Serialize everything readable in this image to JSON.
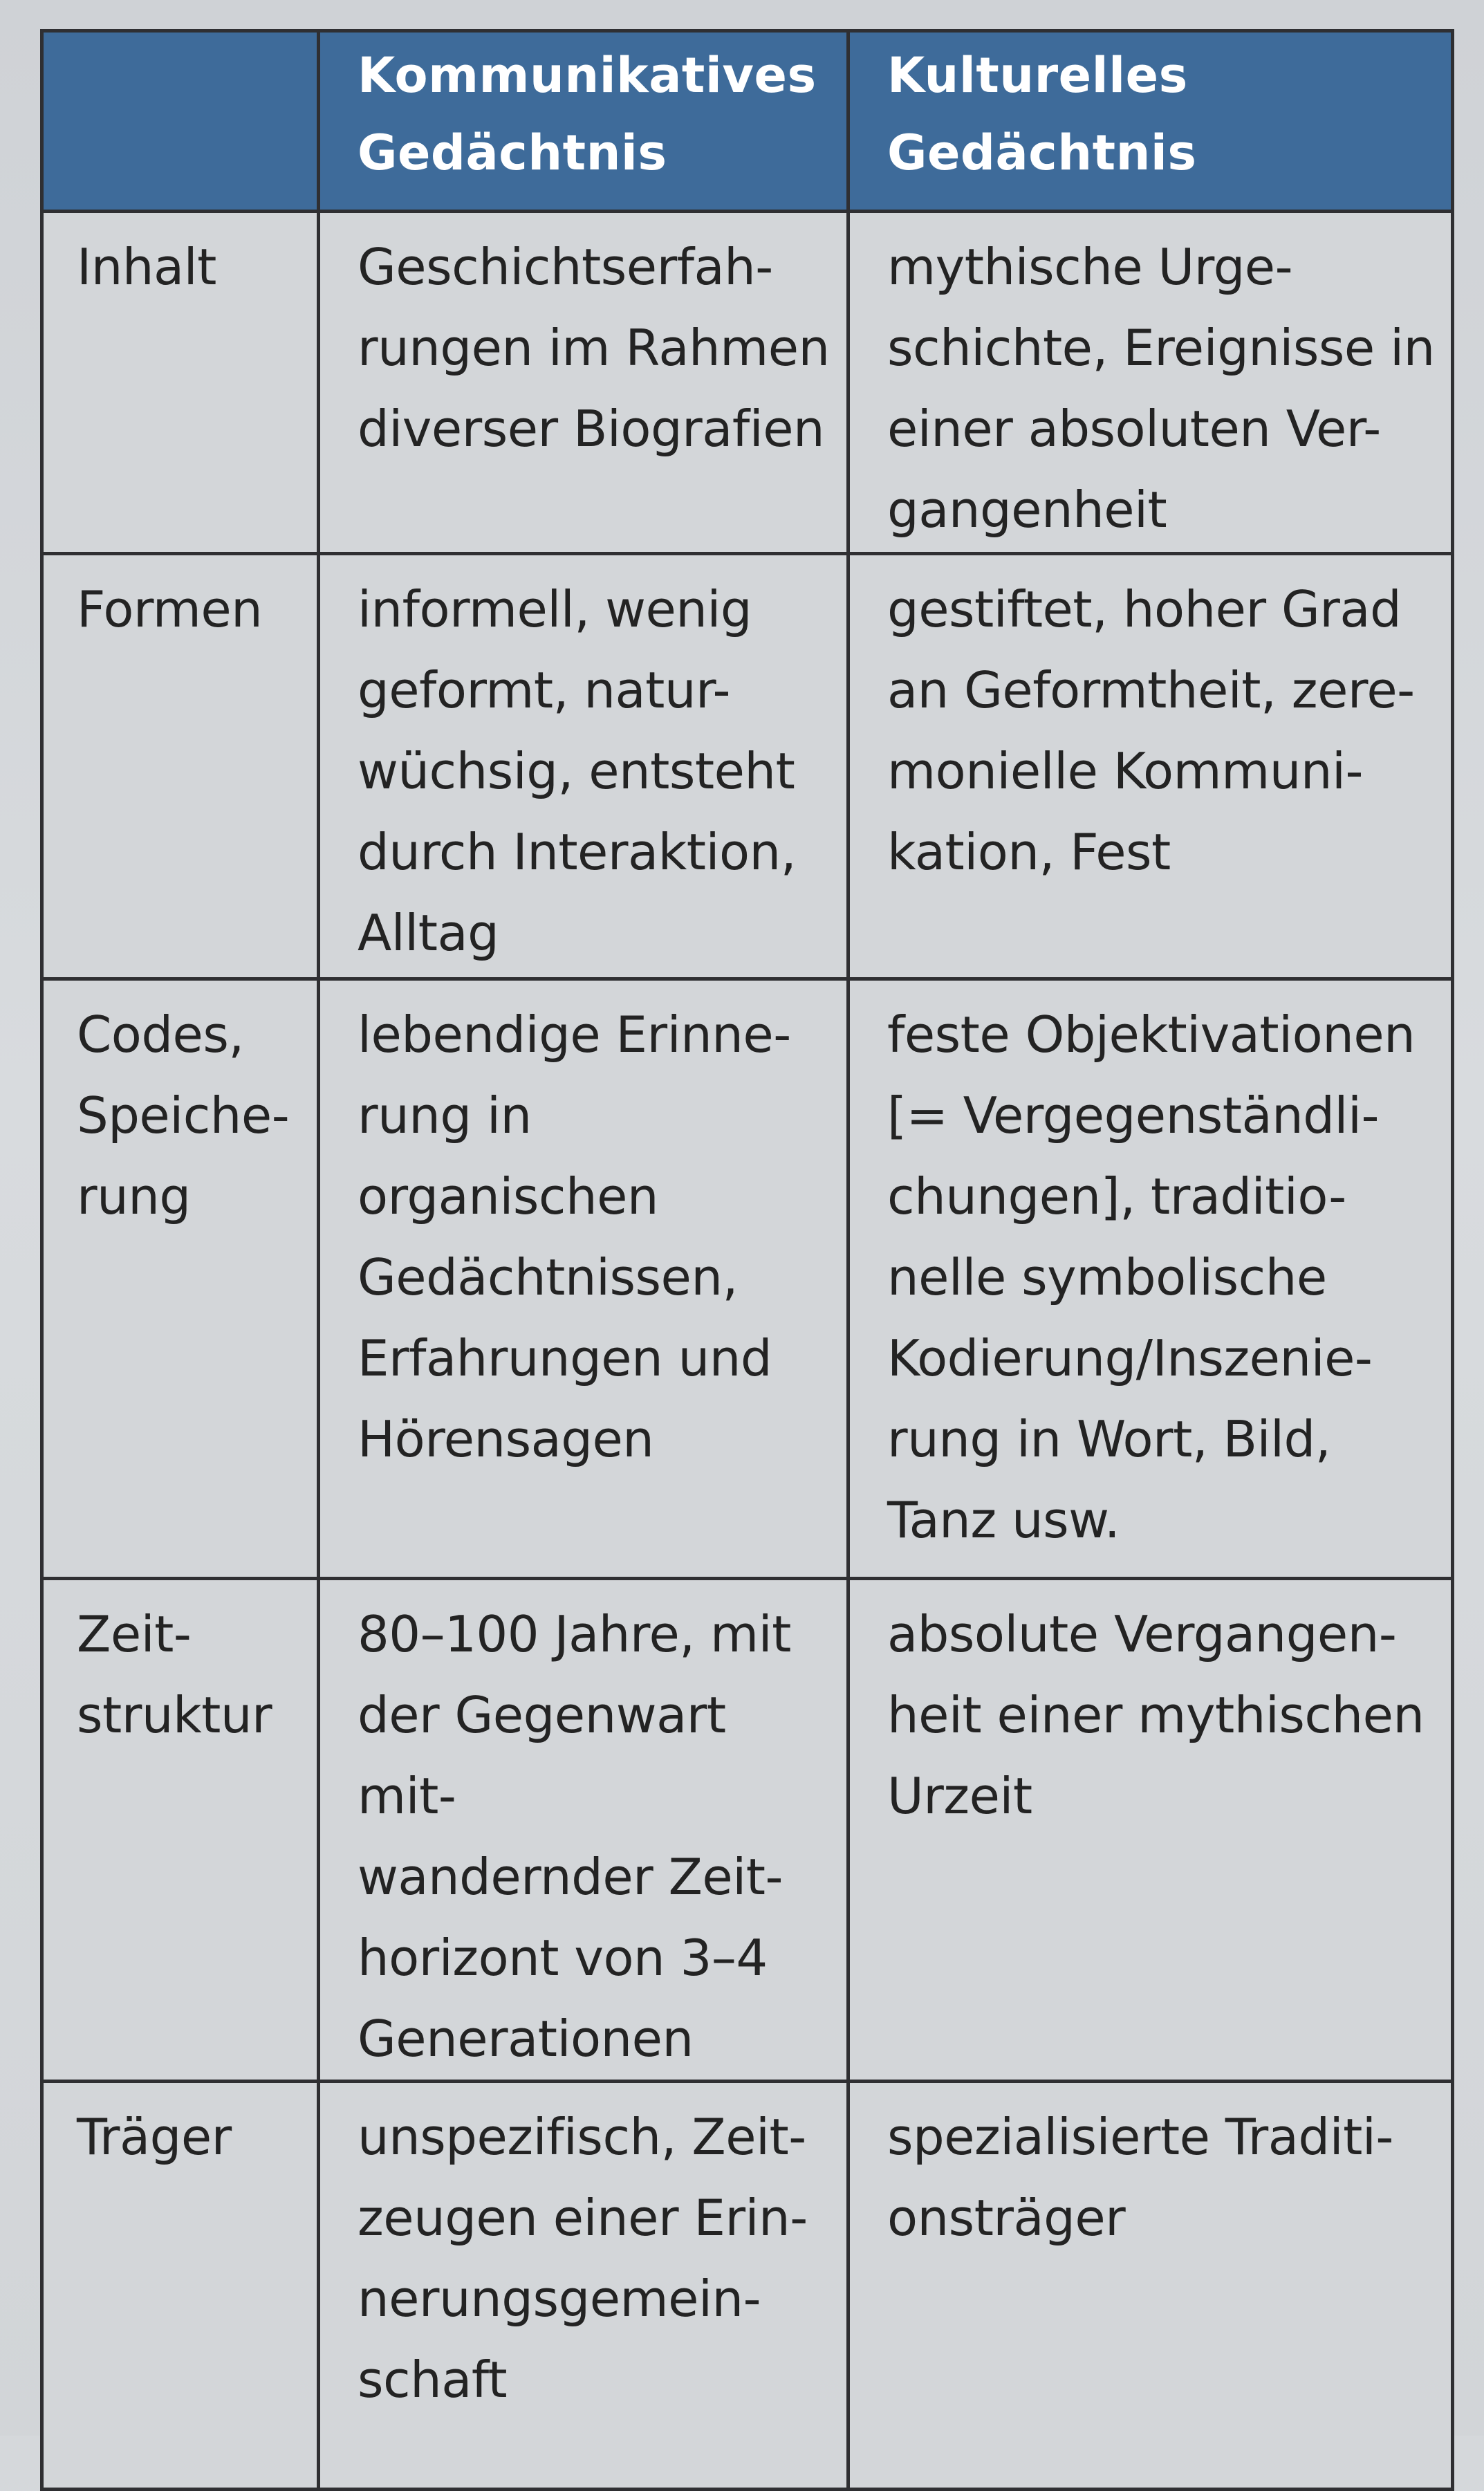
{
  "table": {
    "headers": [
      "",
      "Kommunikatives\nGedächtnis",
      "Kulturelles\nGedächtnis"
    ],
    "rows": [
      {
        "label": "Inhalt",
        "kommunikativ": "Geschichtserfah-\nrungen im Rahmen\ndiverser Biografien",
        "kulturell": "mythische Urge-\nschichte, Ereignisse in\neiner absoluten Ver-\ngangenheit"
      },
      {
        "label": "Formen",
        "kommunikativ": "informell, wenig\ngeformt, natur-\nwüchsig, entsteht\ndurch Interaktion,\nAlltag",
        "kulturell": "gestiftet, hoher Grad\nan Geformtheit, zere-\nmonielle Kommuni-\nkation, Fest"
      },
      {
        "label": "Codes,\nSpeiche-\nrung",
        "kommunikativ": "lebendige Erinne-\nrung in organischen\nGedächtnissen,\nErfahrungen und\nHörensagen",
        "kulturell": "feste Objektivationen\n[= Vergegenständli-\nchungen], traditio-\nnelle symbolische\nKodierung/Inszenie-\nrung in Wort, Bild,\nTanz usw."
      },
      {
        "label": "Zeit-\nstruktur",
        "kommunikativ": "80–100 Jahre, mit\nder Gegenwart mit-\nwandernder Zeit-\nhorizont von 3–4\nGenerationen",
        "kulturell": "absolute Vergangen-\nheit einer mythischen\nUrzeit"
      },
      {
        "label": "Träger",
        "kommunikativ": "unspezifisch, Zeit-\nzeugen einer Erin-\nnerungsgemein-\nschaft",
        "kulturell": "spezialisierte Traditi-\nonsträger"
      }
    ]
  }
}
